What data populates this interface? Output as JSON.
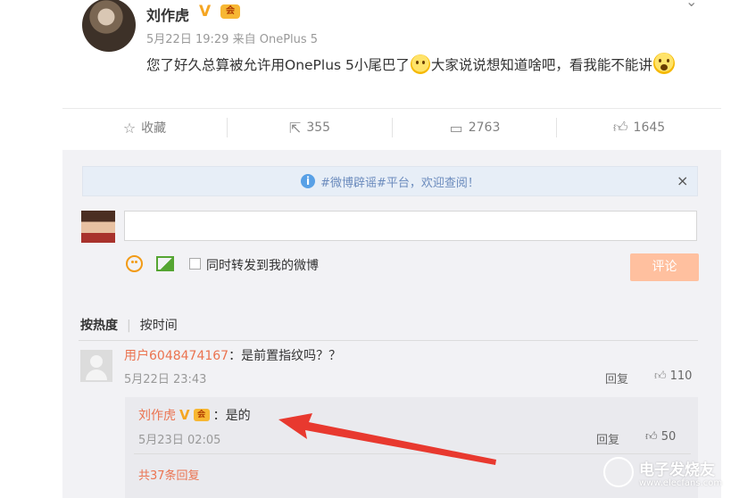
{
  "post": {
    "author": "刘作虎",
    "verified_mark": "V",
    "member_badge": "会",
    "time": "5月22日 19:29",
    "source_prefix": "来自",
    "source": "OnePlus 5",
    "content_part1": "您了好久总算被允许用OnePlus 5小尾巴了",
    "content_part2": "大家说说想知道啥吧，看我能不能讲"
  },
  "actions": {
    "favorite": {
      "icon": "star-icon",
      "label": "收藏"
    },
    "repost": {
      "icon": "share-icon",
      "count": "355"
    },
    "comment": {
      "icon": "comment-icon",
      "count": "2763"
    },
    "like": {
      "icon": "thumbs-up-icon",
      "count": "1645"
    }
  },
  "notice": {
    "text": "#微博辟谣#平台，欢迎查阅！",
    "close_glyph": "×"
  },
  "composer": {
    "input_value": "",
    "also_repost_label": "同时转发到我的微博",
    "submit_label": "评论"
  },
  "sort": {
    "hot": "按热度",
    "time": "按时间"
  },
  "comments": [
    {
      "user": "用户6048474167",
      "text": "：是前置指纹吗？？",
      "time": "5月22日 23:43",
      "reply_label": "回复",
      "likes": "110",
      "replies": [
        {
          "user": "刘作虎",
          "verified_mark": "V",
          "member_badge": "会",
          "text": "：是的",
          "time": "5月23日 02:05",
          "reply_label": "回复",
          "likes": "50"
        }
      ],
      "more_replies": "共37条回复"
    }
  ],
  "watermark": {
    "name": "电子发烧友",
    "url": "www.elecfans.com"
  },
  "colors": {
    "accent": "#eb7350",
    "verified": "#f5a623",
    "arrow": "#e8392f"
  }
}
